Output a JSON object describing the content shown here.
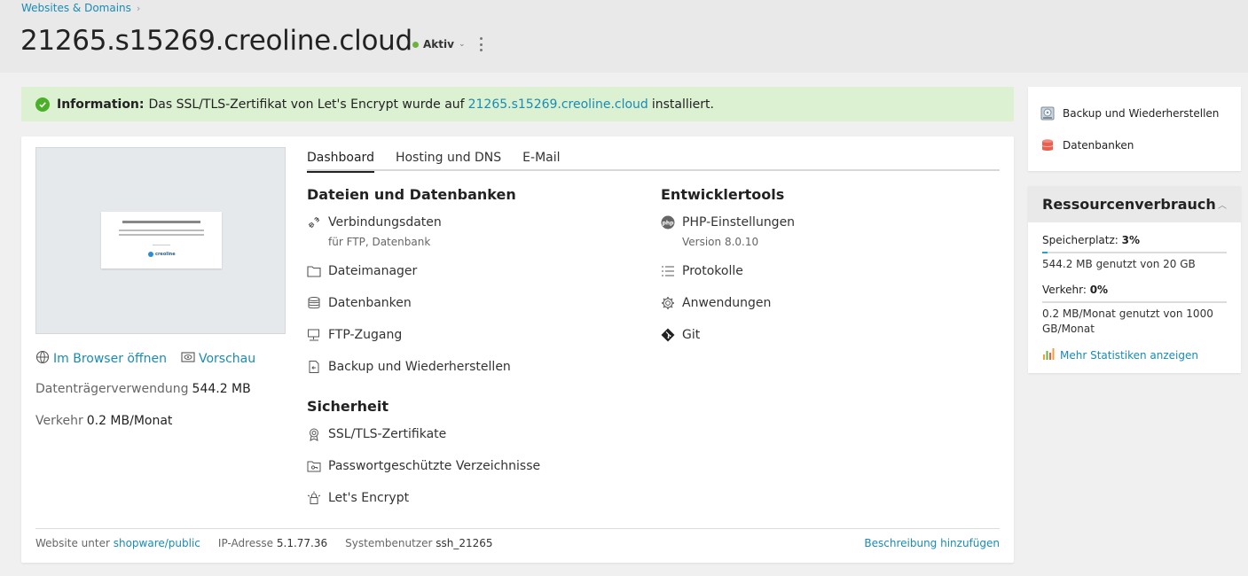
{
  "breadcrumb": {
    "label": "Websites & Domains"
  },
  "page_title": "21265.s15269.creoline.cloud",
  "status": {
    "label": "Aktiv",
    "color": "#6cb33e"
  },
  "banner": {
    "prefix": "Information:",
    "text_before": "Das SSL/TLS-Zertifikat von Let's Encrypt wurde auf",
    "domain_link": "21265.s15269.creoline.cloud",
    "text_after": "installiert."
  },
  "preview_links": {
    "browser": "Im Browser öffnen",
    "preview": "Vorschau"
  },
  "preview_thumb": {
    "brand": "creoline"
  },
  "stats": {
    "disk_label": "Datenträgerverwendung",
    "disk_value": "544.2 MB",
    "traffic_label": "Verkehr",
    "traffic_value": "0.2 MB/Monat"
  },
  "tabs": [
    "Dashboard",
    "Hosting und DNS",
    "E-Mail"
  ],
  "sections": {
    "files": {
      "title": "Dateien und Datenbanken",
      "items": [
        {
          "label": "Verbindungsdaten",
          "sub": "für FTP, Datenbank",
          "icon": "connection-icon"
        },
        {
          "label": "Dateimanager",
          "icon": "folder-icon"
        },
        {
          "label": "Datenbanken",
          "icon": "database-icon"
        },
        {
          "label": "FTP-Zugang",
          "icon": "ftp-icon"
        },
        {
          "label": "Backup und Wiederherstellen",
          "icon": "backup-icon"
        }
      ]
    },
    "security": {
      "title": "Sicherheit",
      "items": [
        {
          "label": "SSL/TLS-Zertifikate",
          "icon": "certificate-icon"
        },
        {
          "label": "Passwortgeschützte Verzeichnisse",
          "icon": "protected-folder-icon"
        },
        {
          "label": "Let's Encrypt",
          "icon": "lets-encrypt-icon"
        }
      ]
    },
    "dev": {
      "title": "Entwicklertools",
      "items": [
        {
          "label": "PHP-Einstellungen",
          "sub": "Version 8.0.10",
          "icon": "php-icon"
        },
        {
          "label": "Protokolle",
          "icon": "list-icon"
        },
        {
          "label": "Anwendungen",
          "icon": "gear-icon"
        },
        {
          "label": "Git",
          "icon": "git-icon"
        }
      ]
    }
  },
  "footer": {
    "site_label": "Website unter",
    "site_link": "shopware/public",
    "ip_label": "IP-Adresse",
    "ip_value": "5.1.77.36",
    "user_label": "Systembenutzer",
    "user_value": "ssh_21265",
    "add_desc": "Beschreibung hinzufügen"
  },
  "side_links": [
    {
      "label": "Backup und Wiederherstellen",
      "icon": "backup-disk-icon"
    },
    {
      "label": "Datenbanken",
      "icon": "database-color-icon"
    }
  ],
  "resources": {
    "title": "Ressourcenverbrauch",
    "disk": {
      "label": "Speicherplatz:",
      "percent": "3%",
      "fill": 0.03,
      "detail": "544.2 MB genutzt von 20 GB"
    },
    "traffic": {
      "label": "Verkehr:",
      "percent": "0%",
      "fill": 0.0,
      "detail": "0.2 MB/Monat genutzt von 1000 GB/Monat"
    },
    "more": "Mehr Statistiken anzeigen"
  }
}
